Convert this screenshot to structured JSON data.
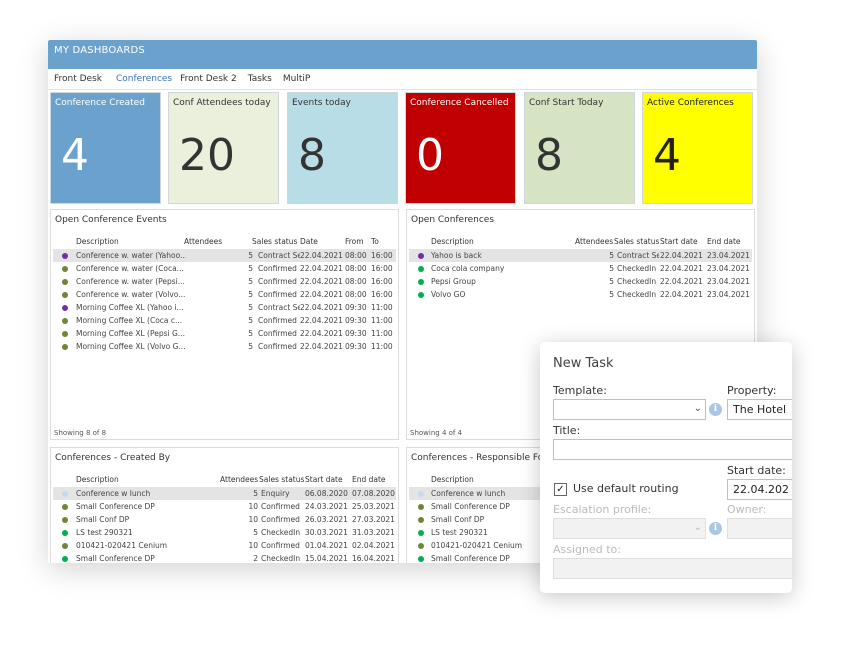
{
  "window_title": "MY DASHBOARDS",
  "tabs": [
    "Front Desk",
    "Conferences",
    "Front Desk 2",
    "Tasks",
    "MultiP"
  ],
  "kpis": [
    {
      "label": "Conference Created",
      "value": "4",
      "bg": "#6aa2cd",
      "fg": "#ffffff"
    },
    {
      "label": "Conf Attendees today",
      "value": "20",
      "bg": "#eaf0dc",
      "fg": "#333333"
    },
    {
      "label": "Events today",
      "value": "8",
      "bg": "#b9dde6",
      "fg": "#333333"
    },
    {
      "label": "Conference Cancelled",
      "value": "0",
      "bg": "#c00000",
      "fg": "#ffffff"
    },
    {
      "label": "Conf Start Today",
      "value": "8",
      "bg": "#d6e4c4",
      "fg": "#333333"
    },
    {
      "label": "Active Conferences",
      "value": "4",
      "bg": "#ffff00",
      "fg": "#222222"
    }
  ],
  "open_events": {
    "title": "Open Conference Events",
    "headers": [
      "Description",
      "Attendees",
      "Sales status",
      "Date",
      "From",
      "To"
    ],
    "rows": [
      {
        "dot": "#7030a0",
        "desc": "Conference w. water (Yahoo...",
        "att": "5",
        "status": "Contract Ser",
        "date": "22.04.2021",
        "from": "08:00",
        "to": "16:00"
      },
      {
        "dot": "#70843a",
        "desc": "Conference w. water (Coca...",
        "att": "5",
        "status": "Confirmed",
        "date": "22.04.2021",
        "from": "08:00",
        "to": "16:00"
      },
      {
        "dot": "#70843a",
        "desc": "Conference w. water (Pepsi...",
        "att": "5",
        "status": "Confirmed",
        "date": "22.04.2021",
        "from": "08:00",
        "to": "16:00"
      },
      {
        "dot": "#70843a",
        "desc": "Conference w. water (Volvo...",
        "att": "5",
        "status": "Confirmed",
        "date": "22.04.2021",
        "from": "08:00",
        "to": "16:00"
      },
      {
        "dot": "#7030a0",
        "desc": "Morning Coffee XL (Yahoo i...",
        "att": "5",
        "status": "Contract Ser",
        "date": "22.04.2021",
        "from": "09:30",
        "to": "11:00"
      },
      {
        "dot": "#70843a",
        "desc": "Morning Coffee XL (Coca c...",
        "att": "5",
        "status": "Confirmed",
        "date": "22.04.2021",
        "from": "09:30",
        "to": "11:00"
      },
      {
        "dot": "#70843a",
        "desc": "Morning Coffee XL (Pepsi G...",
        "att": "5",
        "status": "Confirmed",
        "date": "22.04.2021",
        "from": "09:30",
        "to": "11:00"
      },
      {
        "dot": "#70843a",
        "desc": "Morning Coffee XL (Volvo G...",
        "att": "5",
        "status": "Confirmed",
        "date": "22.04.2021",
        "from": "09:30",
        "to": "11:00"
      }
    ],
    "footer": "Showing 8 of 8"
  },
  "open_conferences": {
    "title": "Open Conferences",
    "headers": [
      "Description",
      "Attendees",
      "Sales status",
      "Start date",
      "End date"
    ],
    "rows": [
      {
        "dot": "#7030a0",
        "desc": "Yahoo is back",
        "att": "5",
        "status": "Contract Ser",
        "start": "22.04.2021",
        "end": "23.04.2021"
      },
      {
        "dot": "#00b050",
        "desc": "Coca cola company",
        "att": "5",
        "status": "CheckedIn",
        "start": "22.04.2021",
        "end": "23.04.2021"
      },
      {
        "dot": "#00b050",
        "desc": "Pepsi Group",
        "att": "5",
        "status": "CheckedIn",
        "start": "22.04.2021",
        "end": "23.04.2021"
      },
      {
        "dot": "#00b050",
        "desc": "Volvo GO",
        "att": "5",
        "status": "CheckedIn",
        "start": "22.04.2021",
        "end": "23.04.2021"
      }
    ],
    "footer": "Showing 4 of 4"
  },
  "created_by": {
    "title": "Conferences - Created By",
    "headers": [
      "Description",
      "Attendees",
      "Sales status",
      "Start date",
      "End date"
    ],
    "rows": [
      {
        "dot": "#c5d9f1",
        "desc": "Conference w lunch",
        "att": "5",
        "status": "Enquiry",
        "start": "06.08.2020",
        "end": "07.08.2020"
      },
      {
        "dot": "#70843a",
        "desc": "Small Conference DP",
        "att": "10",
        "status": "Confirmed",
        "start": "24.03.2021",
        "end": "25.03.2021"
      },
      {
        "dot": "#70843a",
        "desc": "Small Conf DP",
        "att": "10",
        "status": "Confirmed",
        "start": "26.03.2021",
        "end": "27.03.2021"
      },
      {
        "dot": "#00b050",
        "desc": "LS test 290321",
        "att": "5",
        "status": "CheckedIn",
        "start": "30.03.2021",
        "end": "31.03.2021"
      },
      {
        "dot": "#70843a",
        "desc": "010421-020421 Cenium",
        "att": "10",
        "status": "Confirmed",
        "start": "01.04.2021",
        "end": "02.04.2021"
      },
      {
        "dot": "#00b050",
        "desc": "Small Conference DP",
        "att": "2",
        "status": "CheckedIn",
        "start": "15.04.2021",
        "end": "16.04.2021"
      }
    ]
  },
  "responsible_for": {
    "title": "Conferences - Responsible For",
    "headers": [
      "Description"
    ],
    "rows": [
      {
        "dot": "#c5d9f1",
        "desc": "Conference w lunch"
      },
      {
        "dot": "#70843a",
        "desc": "Small Conference DP"
      },
      {
        "dot": "#70843a",
        "desc": "Small Conf DP"
      },
      {
        "dot": "#00b050",
        "desc": "LS test 290321"
      },
      {
        "dot": "#70843a",
        "desc": "010421-020421 Cenium"
      },
      {
        "dot": "#00b050",
        "desc": "Small Conference DP"
      }
    ]
  },
  "new_task": {
    "title": "New Task",
    "template_label": "Template:",
    "template_value": "",
    "property_label": "Property:",
    "property_value": "The Hotel",
    "title_label": "Title:",
    "title_value": "",
    "use_default_routing_label": "Use default routing",
    "use_default_routing_checked": "✓",
    "start_date_label": "Start date:",
    "start_date_value": "22.04.202",
    "escalation_label": "Escalation profile:",
    "owner_label": "Owner:",
    "assigned_label": "Assigned to:"
  }
}
